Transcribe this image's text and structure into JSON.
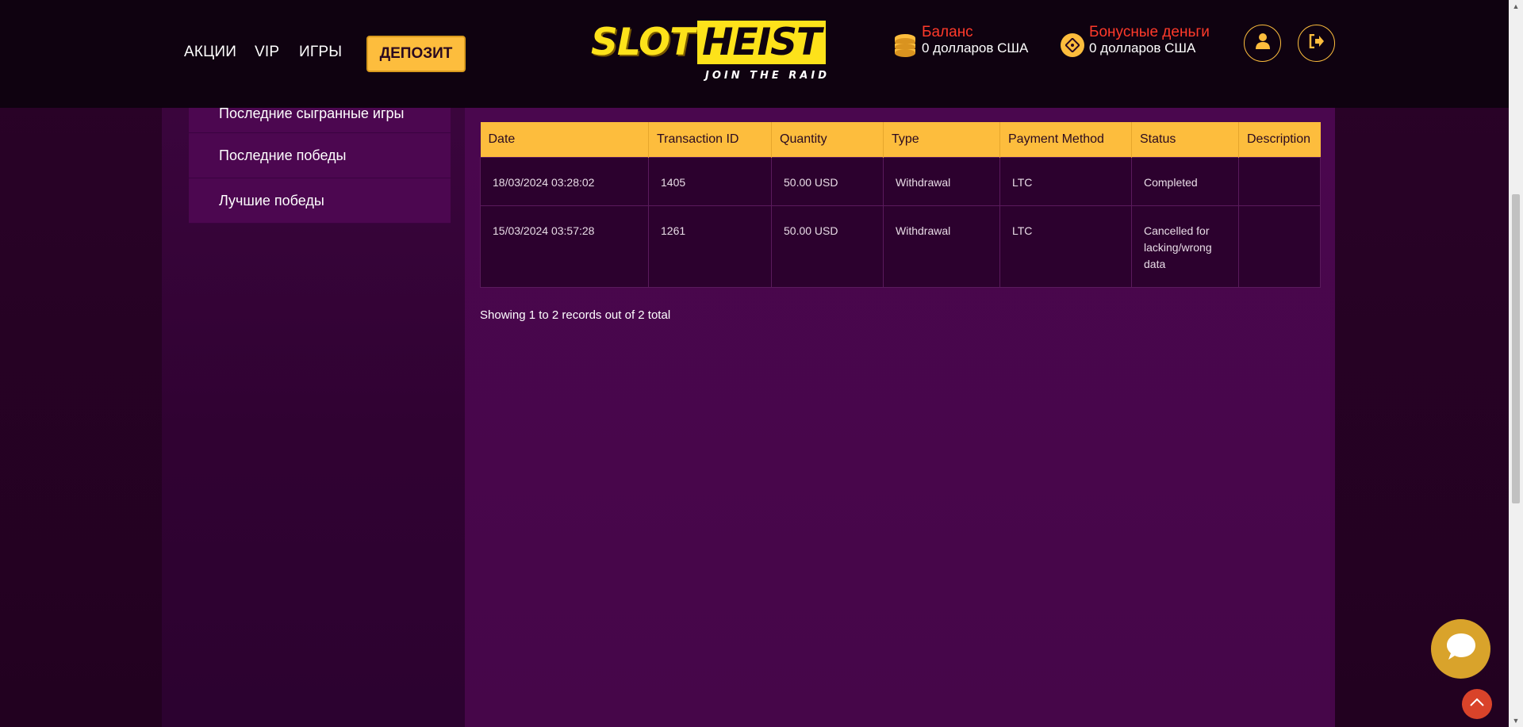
{
  "header": {
    "nav": [
      "АКЦИИ",
      "VIP",
      "ИГРЫ"
    ],
    "deposit_label": "ДЕПОЗИТ",
    "logo": {
      "main": "SLOT",
      "accent": "HEIST",
      "tagline": "JOIN THE RAID"
    },
    "balance": {
      "label": "Баланс",
      "value": "0 долларов США"
    },
    "bonus": {
      "label": "Бонусные деньги",
      "value": "0 долларов США"
    },
    "icons": {
      "profile": "user-icon",
      "logout": "logout-icon",
      "balance": "coins-icon",
      "bonus": "bonus-icon"
    }
  },
  "sidebar": {
    "items": [
      "Последние сыгранные игры",
      "Последние победы",
      "Лучшие победы"
    ]
  },
  "transactions": {
    "columns": [
      "Date",
      "Transaction ID",
      "Quantity",
      "Type",
      "Payment Method",
      "Status",
      "Description"
    ],
    "rows": [
      {
        "date": "18/03/2024 03:28:02",
        "id": "1405",
        "quantity": "50.00 USD",
        "type": "Withdrawal",
        "method": "LTC",
        "status": "Completed",
        "description": ""
      },
      {
        "date": "15/03/2024 03:57:28",
        "id": "1261",
        "quantity": "50.00 USD",
        "type": "Withdrawal",
        "method": "LTC",
        "status": "Cancelled for lacking/wrong data",
        "description": ""
      }
    ],
    "records_info": "Showing 1 to 2 records out of 2 total"
  },
  "colors": {
    "accent": "#fdbd3d",
    "header_bg": "#0f0210",
    "panel_bg": "#4a074e",
    "balance_label": "#ff3a2a"
  }
}
